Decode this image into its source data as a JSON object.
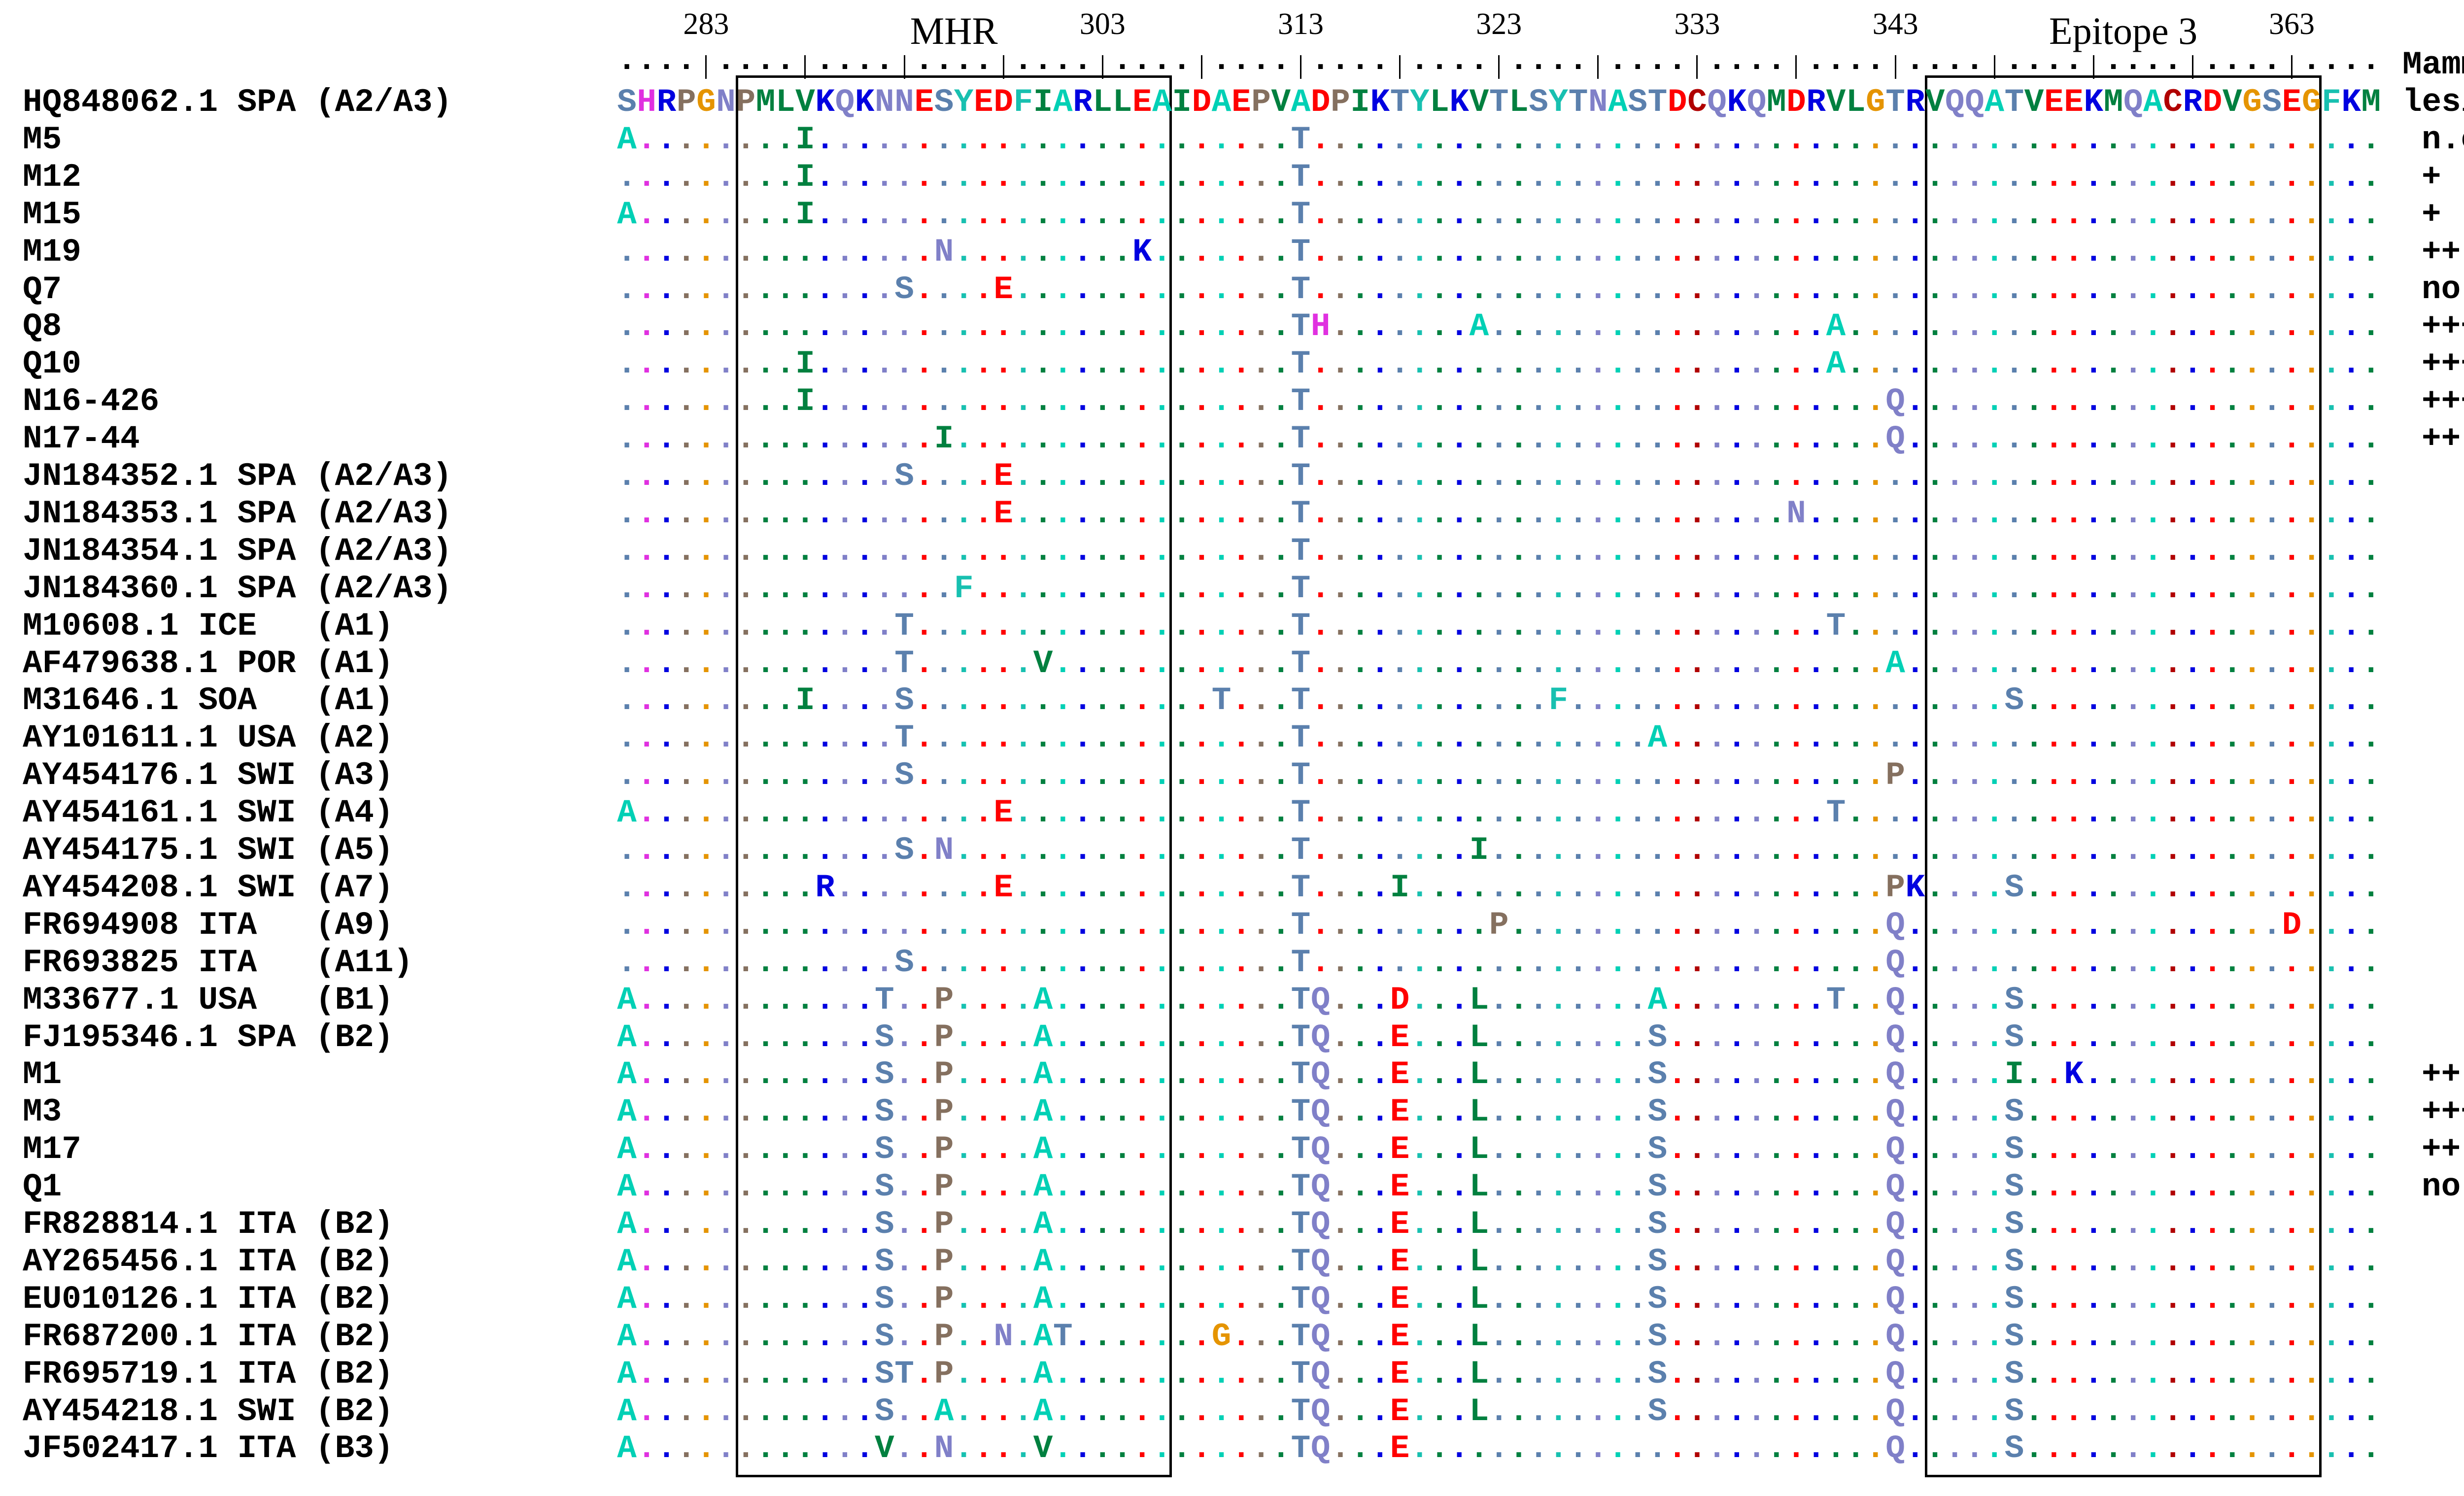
{
  "ruler": {
    "start": 279,
    "end": 367,
    "tick_every": 5,
    "first_tick": 283,
    "numbers": [
      283,
      303,
      313,
      323,
      333,
      343,
      363
    ]
  },
  "regions": [
    {
      "label": "MHR",
      "from": 285,
      "to": 306
    },
    {
      "label": "Epitope 3",
      "from": 345,
      "to": 364
    }
  ],
  "lesions_header": {
    "line1": "Mammary",
    "line2": "lesions"
  },
  "reference": {
    "name": "HQ848062.1",
    "country": "SPA",
    "genotype": "(A2/A3)",
    "sequence": "SHRPGNPMLVKQKNNESYEDFIARLLEAIDAEPVADPIKTYLKVTLSYTNASTDCQKQMDRVLGTRVQQATVEEKMQACRDVGSEGFKM"
  },
  "rows": [
    {
      "name": "M5",
      "country": "",
      "genotype": "",
      "variants": "279A 288I 313T",
      "lesion": "n.c."
    },
    {
      "name": "M12",
      "country": "",
      "genotype": "",
      "variants": "288I 313T",
      "lesion": "+"
    },
    {
      "name": "M15",
      "country": "",
      "genotype": "",
      "variants": "279A 288I 313T",
      "lesion": "+"
    },
    {
      "name": "M19",
      "country": "",
      "genotype": "",
      "variants": "295N 305K 313T",
      "lesion": "++"
    },
    {
      "name": "Q7",
      "country": "",
      "genotype": "",
      "variants": "293S 298E 313T",
      "lesion": "no"
    },
    {
      "name": "Q8",
      "country": "",
      "genotype": "",
      "variants": "313T 314H 322A 340A",
      "lesion": "+++"
    },
    {
      "name": "Q10",
      "country": "",
      "genotype": "",
      "variants": "288I 313T 340A",
      "lesion": "+++"
    },
    {
      "name": "N16-426",
      "country": "",
      "genotype": "",
      "variants": "288I 313T 343Q",
      "lesion": "+++"
    },
    {
      "name": "N17-44",
      "country": "",
      "genotype": "",
      "variants": "295I 313T 343Q",
      "lesion": "++"
    },
    {
      "name": "JN184352.1",
      "country": "SPA",
      "genotype": "(A2/A3)",
      "variants": "293S 298E 313T",
      "lesion": ""
    },
    {
      "name": "JN184353.1",
      "country": "SPA",
      "genotype": "(A2/A3)",
      "variants": "298E 313T 338N",
      "lesion": ""
    },
    {
      "name": "JN184354.1",
      "country": "SPA",
      "genotype": "(A2/A3)",
      "variants": "313T",
      "lesion": ""
    },
    {
      "name": "JN184360.1",
      "country": "SPA",
      "genotype": "(A2/A3)",
      "variants": "296F 313T",
      "lesion": ""
    },
    {
      "name": "M10608.1",
      "country": "ICE",
      "genotype": "(A1)",
      "variants": "293T 313T 340T",
      "lesion": ""
    },
    {
      "name": "AF479638.1",
      "country": "POR",
      "genotype": "(A1)",
      "variants": "293T 300V 313T 343A",
      "lesion": ""
    },
    {
      "name": "M31646.1",
      "country": "SOA",
      "genotype": "(A1)",
      "variants": "288I 293S 309T 313T 326F 349S",
      "lesion": ""
    },
    {
      "name": "AY101611.1",
      "country": "USA",
      "genotype": "(A2)",
      "variants": "293T 313T 331A",
      "lesion": ""
    },
    {
      "name": "AY454176.1",
      "country": "SWI",
      "genotype": "(A3)",
      "variants": "293S 313T 343P",
      "lesion": ""
    },
    {
      "name": "AY454161.1",
      "country": "SWI",
      "genotype": "(A4)",
      "variants": "279A 298E 313T 340T",
      "lesion": ""
    },
    {
      "name": "AY454175.1",
      "country": "SWI",
      "genotype": "(A5)",
      "variants": "293S 295N 313T 322I",
      "lesion": ""
    },
    {
      "name": "AY454208.1",
      "country": "SWI",
      "genotype": "(A7)",
      "variants": "289R 298E 313T 318I 343P 344K 349S",
      "lesion": ""
    },
    {
      "name": "FR694908",
      "country": "ITA",
      "genotype": "(A9)",
      "variants": "313T 323P 343Q 363D",
      "lesion": ""
    },
    {
      "name": "FR693825",
      "country": "ITA",
      "genotype": "(A11)",
      "variants": "293S 313T 343Q",
      "lesion": ""
    },
    {
      "name": "M33677.1",
      "country": "USA",
      "genotype": "(B1)",
      "variants": "279A 292T 295P 300A 313T 314Q 318D 322L 331A 340T 343Q 349S",
      "lesion": ""
    },
    {
      "name": "FJ195346.1",
      "country": "SPA",
      "genotype": "(B2)",
      "variants": "279A 292S 295P 300A 313T 314Q 318E 322L 331S 343Q 349S",
      "lesion": ""
    },
    {
      "name": "M1",
      "country": "",
      "genotype": "",
      "variants": "279A 292S 295P 300A 313T 314Q 318E 322L 331S 343Q 349I 352K",
      "lesion": "++"
    },
    {
      "name": "M3",
      "country": "",
      "genotype": "",
      "variants": "279A 292S 295P 300A 313T 314Q 318E 322L 331S 343Q 349S",
      "lesion": "+++"
    },
    {
      "name": "M17",
      "country": "",
      "genotype": "",
      "variants": "279A 292S 295P 300A 313T 314Q 318E 322L 331S 343Q 349S",
      "lesion": "++"
    },
    {
      "name": "Q1",
      "country": "",
      "genotype": "",
      "variants": "279A 292S 295P 300A 313T 314Q 318E 322L 331S 343Q 349S",
      "lesion": "no"
    },
    {
      "name": "FR828814.1",
      "country": "ITA",
      "genotype": "(B2)",
      "variants": "279A 292S 295P 300A 313T 314Q 318E 322L 331S 343Q 349S",
      "lesion": ""
    },
    {
      "name": "AY265456.1",
      "country": "ITA",
      "genotype": "(B2)",
      "variants": "279A 292S 295P 300A 313T 314Q 318E 322L 331S 343Q 349S",
      "lesion": ""
    },
    {
      "name": "EU010126.1",
      "country": "ITA",
      "genotype": "(B2)",
      "variants": "279A 292S 295P 300A 313T 314Q 318E 322L 331S 343Q 349S",
      "lesion": ""
    },
    {
      "name": "FR687200.1",
      "country": "ITA",
      "genotype": "(B2)",
      "variants": "279A 292S 295P 298N 300A 301T 309G 313T 314Q 318E 322L 331S 343Q 349S",
      "lesion": ""
    },
    {
      "name": "FR695719.1",
      "country": "ITA",
      "genotype": "(B2)",
      "variants": "279A 292S 293T 295P 300A 313T 314Q 318E 322L 331S 343Q 349S",
      "lesion": ""
    },
    {
      "name": "AY454218.1",
      "country": "SWI",
      "genotype": "(B2)",
      "variants": "279A 292S 295A 300A 313T 314Q 318E 322L 331S 343Q 349S",
      "lesion": ""
    },
    {
      "name": "JF502417.1",
      "country": "ITA",
      "genotype": "(B3)",
      "variants": "279A 292V 295N 300V 313T 314Q 318E 343Q 349S",
      "lesion": ""
    }
  ],
  "residue_colors": {
    "S": "#5b80ad",
    "T": "#5b80ad",
    "H": "#e030e0",
    "R": "#0000e0",
    "K": "#0000e0",
    "P": "#85705f",
    "G": "#e59400",
    "N": "#8080c8",
    "Q": "#8080c8",
    "M": "#00803f",
    "L": "#00803f",
    "V": "#00803f",
    "I": "#00803f",
    "E": "#ff0000",
    "D": "#ff0000",
    "Y": "#18c0b0",
    "F": "#18c0b0",
    "A": "#00d0b5",
    "C": "#b00000"
  }
}
